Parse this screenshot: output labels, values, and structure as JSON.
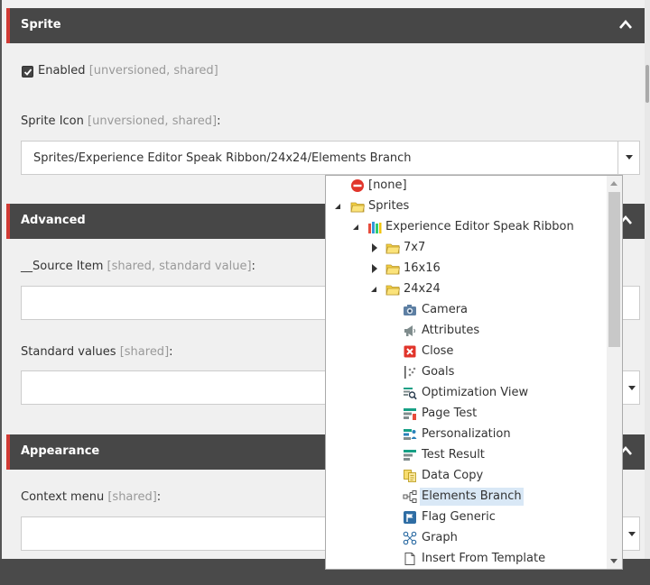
{
  "sections": {
    "sprite": {
      "title": "Sprite"
    },
    "advanced": {
      "title": "Advanced"
    },
    "appearance": {
      "title": "Appearance"
    }
  },
  "fields": {
    "enabled": {
      "label": "Enabled",
      "meta": "[unversioned, shared]",
      "checked": true
    },
    "sprite_icon": {
      "label": "Sprite Icon",
      "meta": "[unversioned, shared]",
      "suffix": ":",
      "value": "Sprites/Experience Editor Speak Ribbon/24x24/Elements Branch"
    },
    "source_item": {
      "label": "__Source Item",
      "meta": "[shared, standard value]",
      "suffix": ":"
    },
    "standard_values": {
      "label": "Standard values",
      "meta": "[shared]",
      "suffix": ":"
    },
    "context_menu": {
      "label": "Context menu",
      "meta": "[shared]",
      "suffix": ":"
    }
  },
  "tree": {
    "none": "[none]",
    "sprites": "Sprites",
    "ribbon": "Experience Editor Speak Ribbon",
    "f7x7": "7x7",
    "f16x16": "16x16",
    "f24x24": "24x24",
    "items": [
      {
        "label": "Camera",
        "icon": "camera-icon"
      },
      {
        "label": "Attributes",
        "icon": "megaphone-icon"
      },
      {
        "label": "Close",
        "icon": "close-icon"
      },
      {
        "label": "Goals",
        "icon": "goals-icon"
      },
      {
        "label": "Optimization View",
        "icon": "optimization-view-icon"
      },
      {
        "label": "Page Test",
        "icon": "page-test-icon"
      },
      {
        "label": "Personalization",
        "icon": "personalization-icon"
      },
      {
        "label": "Test Result",
        "icon": "test-result-icon"
      },
      {
        "label": "Data Copy",
        "icon": "data-copy-icon"
      },
      {
        "label": "Elements Branch",
        "icon": "elements-branch-icon",
        "selected": true
      },
      {
        "label": "Flag Generic",
        "icon": "flag-generic-icon"
      },
      {
        "label": "Graph",
        "icon": "graph-icon"
      },
      {
        "label": "Insert From Template",
        "icon": "insert-from-template-icon"
      }
    ]
  },
  "colors": {
    "header_bg": "#474747",
    "accent": "#d03a34",
    "selection": "#d9e8f6"
  }
}
